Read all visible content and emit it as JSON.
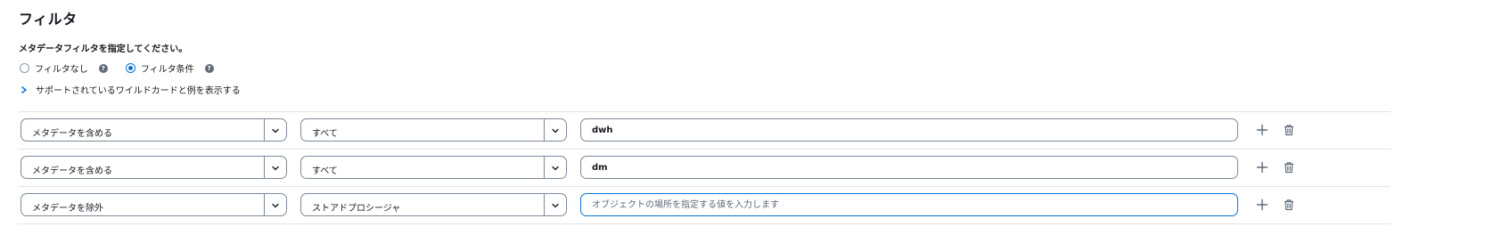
{
  "section": {
    "title": "フィルタ",
    "instruction": "メタデータフィルタを指定してください。"
  },
  "radio": {
    "options": [
      {
        "label": "フィルタなし",
        "checked": false
      },
      {
        "label": "フィルタ条件",
        "checked": true
      }
    ],
    "help_icon": "?"
  },
  "expander": {
    "label": "サポートされているワイルドカードと例を表示する",
    "icon": "chevron-right-icon"
  },
  "rows": [
    {
      "action": "メタデータを含める",
      "object_type": "すべて",
      "value": "dwh",
      "placeholder": ""
    },
    {
      "action": "メタデータを含める",
      "object_type": "すべて",
      "value": "dm",
      "placeholder": ""
    },
    {
      "action": "メタデータを除外",
      "object_type": "ストアドプロシージャ",
      "value": "",
      "placeholder": "オブジェクトの場所を指定する値を入力します"
    }
  ],
  "colors": {
    "accent": "#0972d3",
    "border": "#7d8998",
    "text": "#16191f",
    "icon": "#5f6b7a"
  }
}
